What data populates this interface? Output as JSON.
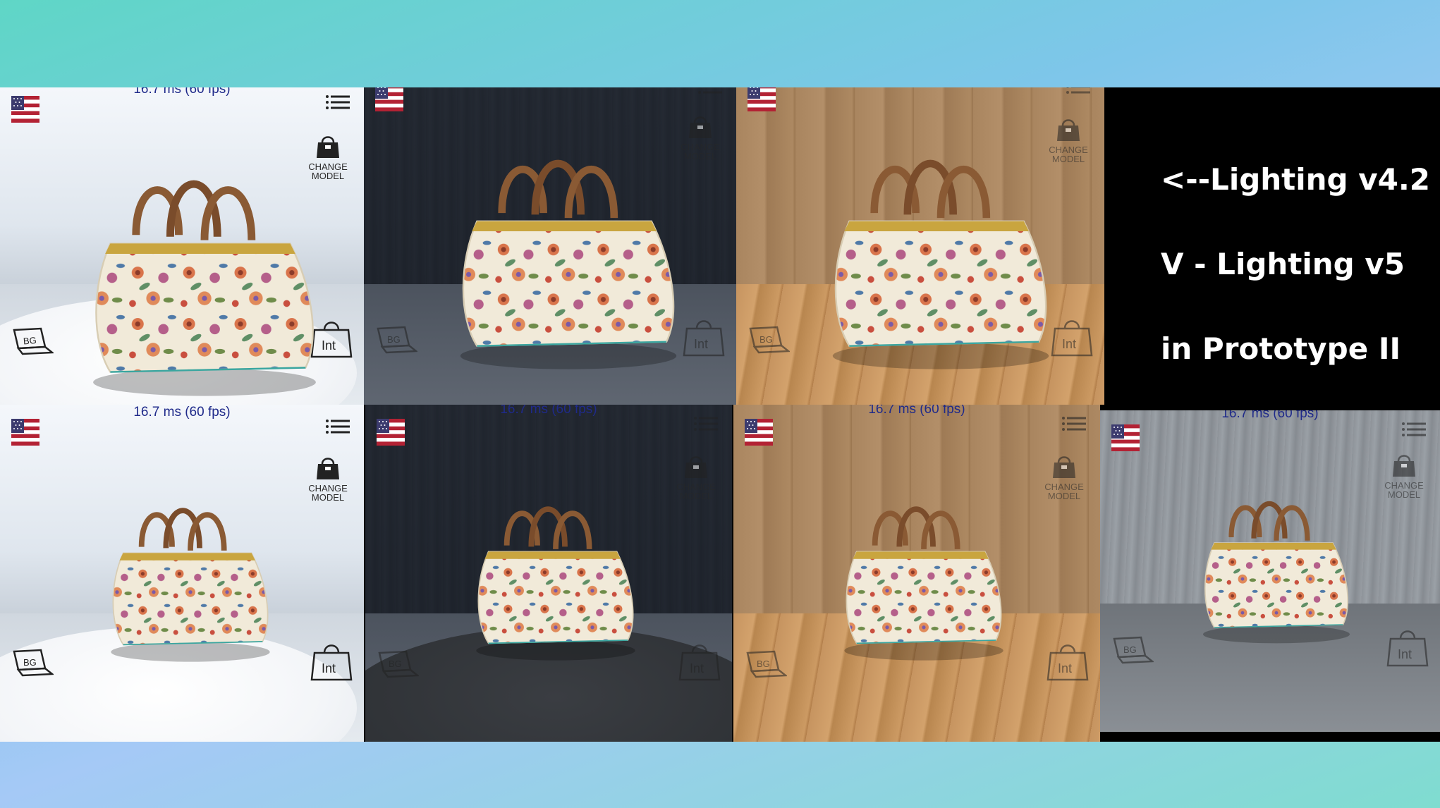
{
  "hud": {
    "fps_text": "16.7 ms (60 fps)",
    "fps_text_cropped": "16.7 ms (60 fps)",
    "change_model_line1": "CHANGE",
    "change_model_line2": "MODEL",
    "bg_label": "BG",
    "int_label": "Int"
  },
  "caption": {
    "line1": "<--Lighting v4.2",
    "line2": "V - Lighting v5",
    "line3": "in Prototype II"
  },
  "colors": {
    "fps_text": "#1f2a8a",
    "bag_handle": "#8a5a34",
    "bag_frame": "#c9a53f",
    "bag_body": "#f1ead9"
  },
  "icons": [
    "us-flag-icon",
    "menu-icon",
    "handbag-icon",
    "laptop-bg-icon",
    "shopping-bag-int-icon"
  ]
}
